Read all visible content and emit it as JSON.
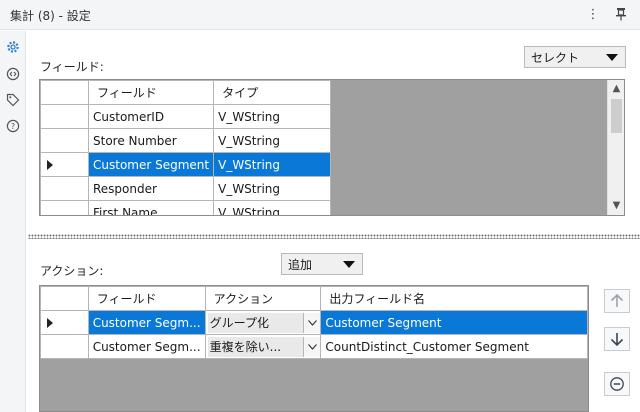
{
  "window": {
    "title": "集計 (8) - 設定",
    "more_icon": "more-vertical-icon",
    "pin_icon": "pin-icon"
  },
  "sidebar": {
    "icons": [
      "gear-icon",
      "connection-icon",
      "tag-icon",
      "help-icon"
    ]
  },
  "fields_section": {
    "label": "フィールド:",
    "select_dropdown": "セレクト",
    "columns": [
      "フィールド",
      "タイプ"
    ],
    "rows": [
      {
        "field": "CustomerID",
        "type": "V_WString",
        "selected": false
      },
      {
        "field": "Store Number",
        "type": "V_WString",
        "selected": false
      },
      {
        "field": "Customer Segment",
        "type": "V_WString",
        "selected": true
      },
      {
        "field": "Responder",
        "type": "V_WString",
        "selected": false
      },
      {
        "field": "First Name",
        "type": "V_WString",
        "selected": false
      }
    ]
  },
  "actions_section": {
    "label": "アクション:",
    "add_dropdown": "追加",
    "columns": [
      "フィールド",
      "アクション",
      "出力フィールド名"
    ],
    "rows": [
      {
        "field": "Customer Segm...",
        "action": "グループ化",
        "output": "Customer Segment",
        "selected": true
      },
      {
        "field": "Customer Segm...",
        "action": "重複を除い...",
        "output": "CountDistinct_Customer Segment",
        "selected": false
      }
    ],
    "side_buttons": [
      "move-up-icon",
      "move-down-icon",
      "remove-icon"
    ]
  }
}
